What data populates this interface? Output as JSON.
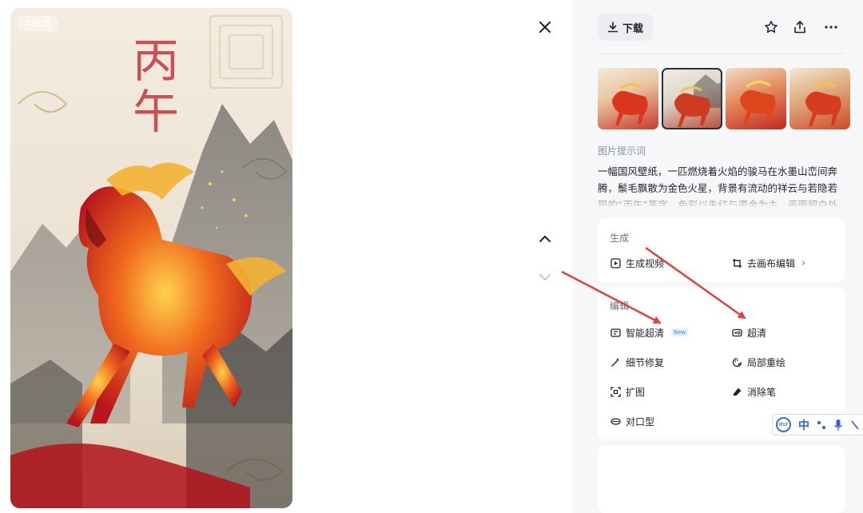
{
  "image": {
    "badge": "AI生成",
    "calligraphy": "丙午"
  },
  "toolbar": {
    "download_label": "下载",
    "icons": [
      "download-icon",
      "star-icon",
      "share-icon",
      "more-icon"
    ]
  },
  "thumbnails": {
    "count": 4,
    "selected_index": 1
  },
  "prompt": {
    "label": "图片提示词",
    "text": "一幅国风壁纸，一匹燃烧着火焰的骏马在水墨山峦间奔腾，鬃毛飘散为金色火星，背景有流动的祥云与若隐若现的“丙午”篆字，色彩以朱红与鎏金为主，画面留白处融入细微的"
  },
  "generate_section": {
    "title": "生成",
    "items": [
      {
        "label": "生成视频",
        "icon": "play-icon"
      },
      {
        "label": "去画布编辑",
        "icon": "canvas-crop-icon"
      }
    ]
  },
  "edit_section": {
    "title": "编辑",
    "items": [
      {
        "label": "智能超清",
        "icon": "smart-hd-icon",
        "badge": "New"
      },
      {
        "label": "超清",
        "icon": "hd-icon"
      },
      {
        "label": "细节修复",
        "icon": "magic-wand-icon"
      },
      {
        "label": "局部重绘",
        "icon": "brush-palette-icon"
      },
      {
        "label": "扩图",
        "icon": "expand-icon"
      },
      {
        "label": "消除笔",
        "icon": "eraser-icon"
      },
      {
        "label": "对口型",
        "icon": "lip-sync-icon"
      }
    ]
  },
  "ime": {
    "logo": "iFLY",
    "mode": "中"
  },
  "colors": {
    "accent_red": "#e3413d",
    "panel_bg": "#f6f7f9",
    "new_badge": "#3b8fd6"
  }
}
